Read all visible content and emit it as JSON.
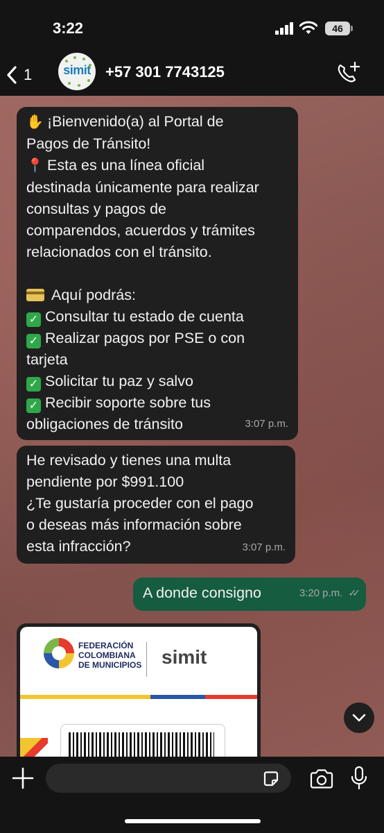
{
  "status_bar": {
    "time": "3:22",
    "battery": "46"
  },
  "header": {
    "back_count": "1",
    "avatar_text": "simit",
    "contact": "+57 301 7743125"
  },
  "messages": [
    {
      "direction": "incoming",
      "lines": [
        "¡Bienvenido(a) al Portal de",
        "Pagos de Tránsito!",
        "Esta es una línea oficial",
        "destinada únicamente para realizar",
        "consultas y pagos de",
        "comparendos, acuerdos y trámites",
        "relacionados con el tránsito.",
        "",
        "Aquí podrás:",
        "Consultar tu estado de cuenta",
        "Realizar pagos por PSE o con",
        "tarjeta",
        "Solicitar tu paz y salvo",
        "Recibir soporte sobre tus",
        "obligaciones de tránsito"
      ],
      "time": "3:07 p.m."
    },
    {
      "direction": "incoming",
      "lines": [
        "He revisado y tienes una multa",
        "pendiente por $991.100",
        " ¿Te gustaría proceder con el pago",
        "o deseas más información sobre",
        "esta infracción?"
      ],
      "time": "3:07 p.m."
    },
    {
      "direction": "outgoing",
      "lines": [
        "A donde consigno"
      ],
      "time": "3:20 p.m."
    }
  ],
  "image_message": {
    "fed_lines": [
      "FEDERACIÓN",
      "COLOMBIANA",
      "DE MUNICIPIOS"
    ],
    "brand": "simit"
  },
  "input": {
    "placeholder": ""
  },
  "icons": {
    "back": "chevron-left-icon",
    "call": "phone-plus-icon",
    "plus": "plus-icon",
    "sticker": "sticker-icon",
    "camera": "camera-icon",
    "mic": "microphone-icon",
    "scroll": "chevron-down-icon"
  },
  "colors": {
    "incoming_bubble": "#1f1f1f",
    "outgoing_bubble": "#155c40",
    "bar": "#141414"
  }
}
